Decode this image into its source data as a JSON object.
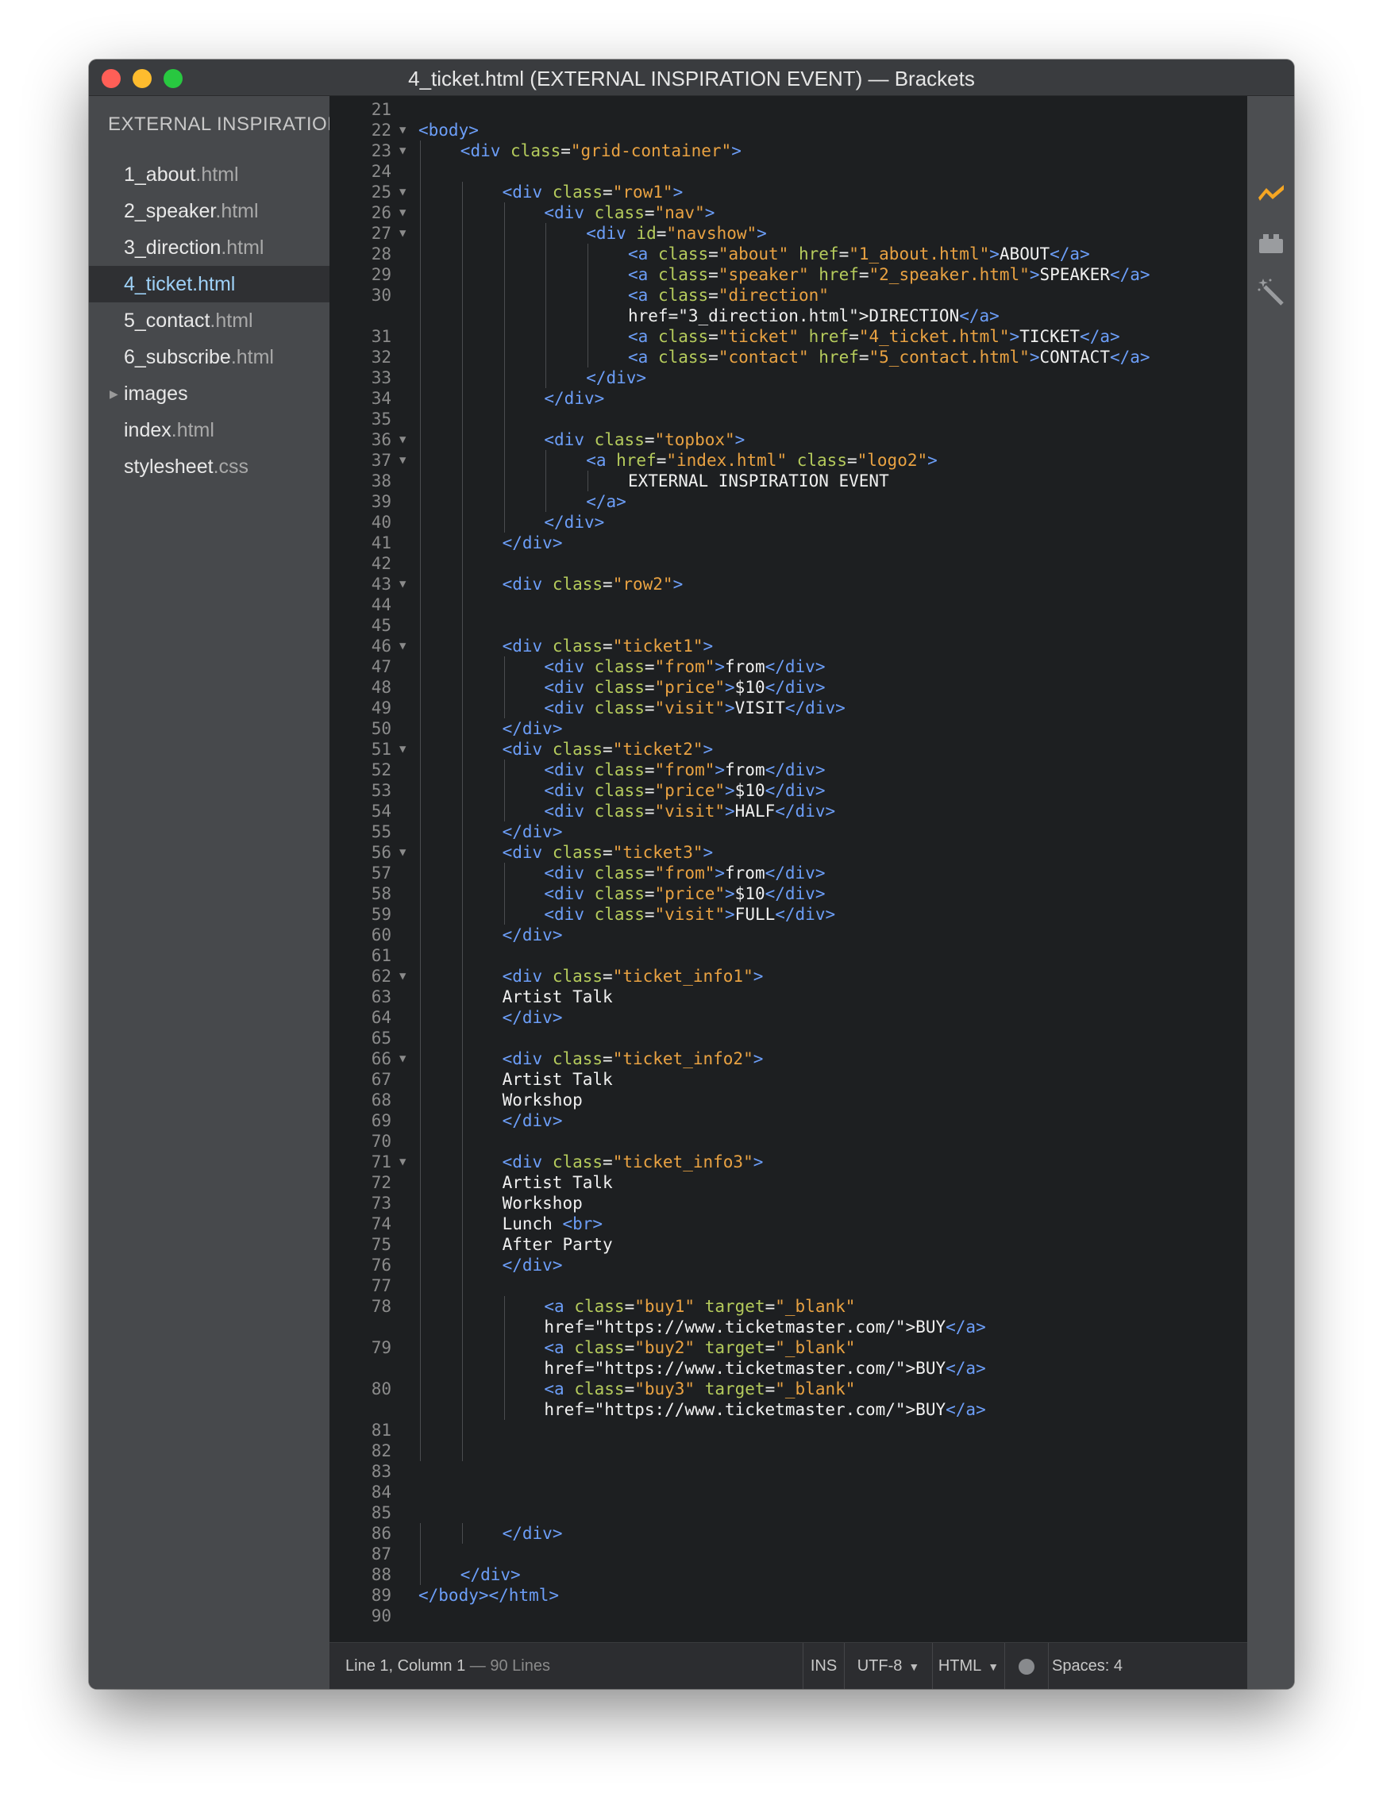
{
  "window": {
    "title": "4_ticket.html (EXTERNAL INSPIRATION EVENT) — Brackets"
  },
  "sidebar": {
    "project_title": "EXTERNAL INSPIRATION EVENT",
    "files": [
      {
        "name": "1_about",
        "ext": ".html",
        "selected": false,
        "folder": false
      },
      {
        "name": "2_speaker",
        "ext": ".html",
        "selected": false,
        "folder": false
      },
      {
        "name": "3_direction",
        "ext": ".html",
        "selected": false,
        "folder": false
      },
      {
        "name": "4_ticket",
        "ext": ".html",
        "selected": true,
        "folder": false
      },
      {
        "name": "5_contact",
        "ext": ".html",
        "selected": false,
        "folder": false
      },
      {
        "name": "6_subscribe",
        "ext": ".html",
        "selected": false,
        "folder": false
      },
      {
        "name": "images",
        "ext": "",
        "selected": false,
        "folder": true
      },
      {
        "name": "index",
        "ext": ".html",
        "selected": false,
        "folder": false
      },
      {
        "name": "stylesheet",
        "ext": ".css",
        "selected": false,
        "folder": false
      }
    ]
  },
  "editor": {
    "lines": [
      {
        "n": "21",
        "fold": false,
        "indent": 0,
        "code": ""
      },
      {
        "n": "22",
        "fold": true,
        "indent": 0,
        "code": "<body>"
      },
      {
        "n": "23",
        "fold": true,
        "indent": 1,
        "code": "<div class=\"grid-container\">"
      },
      {
        "n": "24",
        "fold": false,
        "indent": 1,
        "code": ""
      },
      {
        "n": "25",
        "fold": true,
        "indent": 2,
        "code": "<div class=\"row1\">"
      },
      {
        "n": "26",
        "fold": true,
        "indent": 3,
        "code": "<div class=\"nav\">"
      },
      {
        "n": "27",
        "fold": true,
        "indent": 4,
        "code": "<div id=\"navshow\">"
      },
      {
        "n": "28",
        "fold": false,
        "indent": 5,
        "code": "<a class=\"about\" href=\"1_about.html\">ABOUT</a>"
      },
      {
        "n": "29",
        "fold": false,
        "indent": 5,
        "code": "<a class=\"speaker\" href=\"2_speaker.html\">SPEAKER</a>"
      },
      {
        "n": "30",
        "fold": false,
        "indent": 5,
        "code": "<a class=\"direction\""
      },
      {
        "n": "",
        "fold": false,
        "indent": 5,
        "code": "href=\"3_direction.html\">DIRECTION</a>"
      },
      {
        "n": "31",
        "fold": false,
        "indent": 5,
        "code": "<a class=\"ticket\" href=\"4_ticket.html\">TICKET</a>"
      },
      {
        "n": "32",
        "fold": false,
        "indent": 5,
        "code": "<a class=\"contact\" href=\"5_contact.html\">CONTACT</a>"
      },
      {
        "n": "33",
        "fold": false,
        "indent": 4,
        "code": "</div>"
      },
      {
        "n": "34",
        "fold": false,
        "indent": 3,
        "code": "</div>"
      },
      {
        "n": "35",
        "fold": false,
        "indent": 3,
        "code": ""
      },
      {
        "n": "36",
        "fold": true,
        "indent": 3,
        "code": "<div class=\"topbox\">"
      },
      {
        "n": "37",
        "fold": true,
        "indent": 4,
        "code": "<a href=\"index.html\" class=\"logo2\">"
      },
      {
        "n": "38",
        "fold": false,
        "indent": 5,
        "code": "EXTERNAL INSPIRATION EVENT"
      },
      {
        "n": "39",
        "fold": false,
        "indent": 4,
        "code": "</a>"
      },
      {
        "n": "40",
        "fold": false,
        "indent": 3,
        "code": "</div>"
      },
      {
        "n": "41",
        "fold": false,
        "indent": 2,
        "code": "</div>"
      },
      {
        "n": "42",
        "fold": false,
        "indent": 2,
        "code": ""
      },
      {
        "n": "43",
        "fold": true,
        "indent": 2,
        "code": "<div class=\"row2\">"
      },
      {
        "n": "44",
        "fold": false,
        "indent": 2,
        "code": ""
      },
      {
        "n": "45",
        "fold": false,
        "indent": 2,
        "code": ""
      },
      {
        "n": "46",
        "fold": true,
        "indent": 2,
        "code": "<div class=\"ticket1\">"
      },
      {
        "n": "47",
        "fold": false,
        "indent": 3,
        "code": "<div class=\"from\">from</div>"
      },
      {
        "n": "48",
        "fold": false,
        "indent": 3,
        "code": "<div class=\"price\">$10</div>"
      },
      {
        "n": "49",
        "fold": false,
        "indent": 3,
        "code": "<div class=\"visit\">VISIT</div>"
      },
      {
        "n": "50",
        "fold": false,
        "indent": 2,
        "code": "</div>"
      },
      {
        "n": "51",
        "fold": true,
        "indent": 2,
        "code": "<div class=\"ticket2\">"
      },
      {
        "n": "52",
        "fold": false,
        "indent": 3,
        "code": "<div class=\"from\">from</div>"
      },
      {
        "n": "53",
        "fold": false,
        "indent": 3,
        "code": "<div class=\"price\">$10</div>"
      },
      {
        "n": "54",
        "fold": false,
        "indent": 3,
        "code": "<div class=\"visit\">HALF</div>"
      },
      {
        "n": "55",
        "fold": false,
        "indent": 2,
        "code": "</div>"
      },
      {
        "n": "56",
        "fold": true,
        "indent": 2,
        "code": "<div class=\"ticket3\">"
      },
      {
        "n": "57",
        "fold": false,
        "indent": 3,
        "code": "<div class=\"from\">from</div>"
      },
      {
        "n": "58",
        "fold": false,
        "indent": 3,
        "code": "<div class=\"price\">$10</div>"
      },
      {
        "n": "59",
        "fold": false,
        "indent": 3,
        "code": "<div class=\"visit\">FULL</div>"
      },
      {
        "n": "60",
        "fold": false,
        "indent": 2,
        "code": "</div>"
      },
      {
        "n": "61",
        "fold": false,
        "indent": 2,
        "code": ""
      },
      {
        "n": "62",
        "fold": true,
        "indent": 2,
        "code": "<div class=\"ticket_info1\">"
      },
      {
        "n": "63",
        "fold": false,
        "indent": 2,
        "code": "Artist Talk"
      },
      {
        "n": "64",
        "fold": false,
        "indent": 2,
        "code": "</div>"
      },
      {
        "n": "65",
        "fold": false,
        "indent": 2,
        "code": ""
      },
      {
        "n": "66",
        "fold": true,
        "indent": 2,
        "code": "<div class=\"ticket_info2\">"
      },
      {
        "n": "67",
        "fold": false,
        "indent": 2,
        "code": "Artist Talk"
      },
      {
        "n": "68",
        "fold": false,
        "indent": 2,
        "code": "Workshop"
      },
      {
        "n": "69",
        "fold": false,
        "indent": 2,
        "code": "</div>"
      },
      {
        "n": "70",
        "fold": false,
        "indent": 2,
        "code": ""
      },
      {
        "n": "71",
        "fold": true,
        "indent": 2,
        "code": "<div class=\"ticket_info3\">"
      },
      {
        "n": "72",
        "fold": false,
        "indent": 2,
        "code": "Artist Talk"
      },
      {
        "n": "73",
        "fold": false,
        "indent": 2,
        "code": "Workshop"
      },
      {
        "n": "74",
        "fold": false,
        "indent": 2,
        "code": "Lunch <br>"
      },
      {
        "n": "75",
        "fold": false,
        "indent": 2,
        "code": "After Party"
      },
      {
        "n": "76",
        "fold": false,
        "indent": 2,
        "code": "</div>"
      },
      {
        "n": "77",
        "fold": false,
        "indent": 2,
        "code": ""
      },
      {
        "n": "78",
        "fold": false,
        "indent": 3,
        "code": "<a class=\"buy1\" target=\"_blank\""
      },
      {
        "n": "",
        "fold": false,
        "indent": 3,
        "code": "href=\"https://www.ticketmaster.com/\">BUY</a>"
      },
      {
        "n": "79",
        "fold": false,
        "indent": 3,
        "code": "<a class=\"buy2\" target=\"_blank\""
      },
      {
        "n": "",
        "fold": false,
        "indent": 3,
        "code": "href=\"https://www.ticketmaster.com/\">BUY</a>"
      },
      {
        "n": "80",
        "fold": false,
        "indent": 3,
        "code": "<a class=\"buy3\" target=\"_blank\""
      },
      {
        "n": "",
        "fold": false,
        "indent": 3,
        "code": "href=\"https://www.ticketmaster.com/\">BUY</a>"
      },
      {
        "n": "81",
        "fold": false,
        "indent": 2,
        "code": ""
      },
      {
        "n": "82",
        "fold": false,
        "indent": 2,
        "code": ""
      },
      {
        "n": "83",
        "fold": false,
        "indent": 0,
        "code": ""
      },
      {
        "n": "84",
        "fold": false,
        "indent": 0,
        "code": ""
      },
      {
        "n": "85",
        "fold": false,
        "indent": 0,
        "code": ""
      },
      {
        "n": "86",
        "fold": false,
        "indent": 2,
        "code": "</div>"
      },
      {
        "n": "87",
        "fold": false,
        "indent": 1,
        "code": ""
      },
      {
        "n": "88",
        "fold": false,
        "indent": 1,
        "code": "</div>"
      },
      {
        "n": "89",
        "fold": false,
        "indent": 0,
        "code": "</body></html>"
      },
      {
        "n": "90",
        "fold": false,
        "indent": 0,
        "code": ""
      }
    ]
  },
  "statusbar": {
    "cursor_position": "Line 1, Column 1",
    "line_count": "— 90 Lines",
    "mode": "INS",
    "encoding": "UTF-8",
    "language": "HTML",
    "indent": "Spaces: 4"
  },
  "toolbar": {
    "icons": [
      "live-preview-icon",
      "extension-manager-icon",
      "beautify-wand-icon"
    ],
    "live_preview_color": "#f5a623"
  }
}
